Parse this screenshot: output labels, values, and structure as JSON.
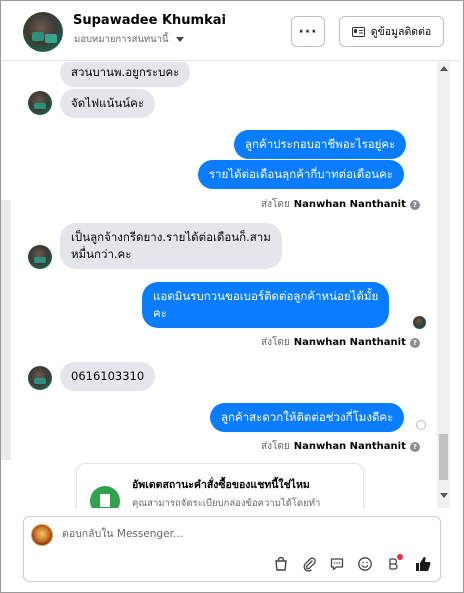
{
  "header": {
    "contact_name": "Supawadee Khumkai",
    "assigned_label": "มอบหมายการสนทนานี้",
    "more_label": "···",
    "contact_info_label": "ดูข้อมูลติดต่อ"
  },
  "messages": [
    {
      "direction": "in",
      "text": "สวนบานพ.อยูกระบคะ"
    },
    {
      "direction": "in",
      "text": "จัดไฟแน้นน์คะ"
    },
    {
      "direction": "out",
      "text": "ลูกค้าประกอบอาชีพอะไรอยู่คะ"
    },
    {
      "direction": "out",
      "text": "รายได้ต่อเดือนลุกค้ากี่บาทต่อเดือนคะ"
    },
    {
      "direction": "in",
      "text_line1": "เป็นลูกจ้างกรีดยาง.รายได้ต่อเดือนก็.สาม",
      "text_line2": "หมื่นกว่า.คะ"
    },
    {
      "direction": "out",
      "text_line1": "แอดมินรบกวนขอเบอร์ติดต่อลูกค้าหน่อยได้มั้ย",
      "text_line2": "คะ"
    },
    {
      "direction": "in",
      "text": "0616103310"
    },
    {
      "direction": "out",
      "text": "ลูกค้าสะดวกให้ติดต่อช่วงกี่โมงดีคะ"
    }
  ],
  "sent_by": {
    "prefix": "ส่งโดย",
    "agent": "Nanwhan Nanthanit",
    "help_glyph": "?"
  },
  "card": {
    "title": "อัพเดตสถานะคำสั่งซื้อของแชทนี้ใช่ไหม",
    "text": "คุณสามารถจัดระเบียบกล่องข้อความได้โดยทำ"
  },
  "composer": {
    "placeholder": "ตอบกลับใน Messenger..."
  },
  "toolbar": {
    "icons": [
      "shopping-bag-icon",
      "paperclip-icon",
      "saved-reply-icon",
      "emoji-icon",
      "bot-icon",
      "like-icon"
    ]
  },
  "colors": {
    "outgoing_bubble": "#0a7cff",
    "incoming_bubble": "#e4e6eb",
    "like": "#1a1a1a",
    "notification": "#f02849"
  }
}
